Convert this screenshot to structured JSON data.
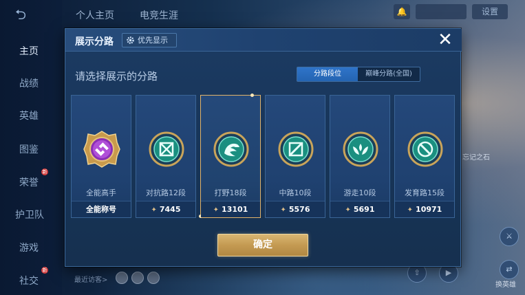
{
  "background": {
    "top_tabs": [
      "个人主页",
      "电竞生涯"
    ],
    "settings_label": "设置",
    "nav": [
      "主页",
      "战绩",
      "英雄",
      "图鉴",
      "荣誉",
      "护卫队",
      "游戏",
      "社交"
    ],
    "recent_visitors_label": "最近访客>",
    "side_label_1": "忘记之石",
    "side_label_2": "换英雄"
  },
  "modal": {
    "title": "展示分路",
    "priority_button": "优先显示",
    "close_icon": "close-icon",
    "prompt": "请选择展示的分路",
    "toggle": {
      "active": "分路段位",
      "inactive": "巅峰分路(全国)"
    },
    "confirm_label": "确定"
  },
  "cards": [
    {
      "icon": "all-round-emblem",
      "label": "全能高手",
      "bottom": "全能称号",
      "points": null,
      "selected": false
    },
    {
      "icon": "clash-lane-emblem",
      "label": "对抗路12段",
      "bottom": "7445",
      "points": true,
      "selected": false
    },
    {
      "icon": "jungle-emblem",
      "label": "打野18段",
      "bottom": "13101",
      "points": true,
      "selected": true
    },
    {
      "icon": "mid-lane-emblem",
      "label": "中路10段",
      "bottom": "5576",
      "points": true,
      "selected": false
    },
    {
      "icon": "roam-emblem",
      "label": "游走10段",
      "bottom": "5691",
      "points": true,
      "selected": false
    },
    {
      "icon": "farm-lane-emblem",
      "label": "发育路15段",
      "bottom": "10971",
      "points": true,
      "selected": false
    }
  ],
  "colors": {
    "accent_gold": "#e3b46a",
    "toggle_active": "#2f74c9",
    "emblem_teal": "#2cc7b0",
    "emblem_purple": "#b04fd8"
  }
}
